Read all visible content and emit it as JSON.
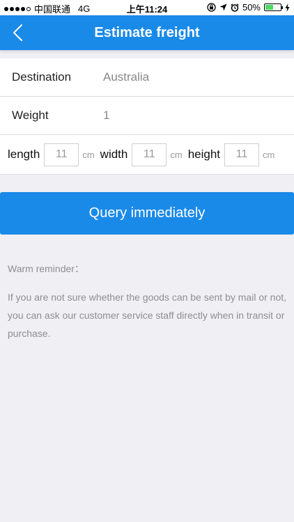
{
  "status_bar": {
    "carrier": "中国联通",
    "network": "4G",
    "time": "上午11:24",
    "battery": "50%",
    "battery_level": 0.5,
    "icons": [
      "orientation-lock-icon",
      "location-icon",
      "alarm-icon",
      "charging-icon"
    ]
  },
  "nav": {
    "title": "Estimate freight",
    "back_icon": "chevron-left-icon"
  },
  "form": {
    "destination_label": "Destination",
    "destination_value": "Australia",
    "weight_label": "Weight",
    "weight_value": "1",
    "length_label": "length",
    "length_value": "11",
    "width_label": "width",
    "width_value": "11",
    "height_label": "height",
    "height_value": "11",
    "unit": "cm"
  },
  "query_button": "Query immediately",
  "reminder": {
    "title": "Warm reminder：",
    "text": "If you are not sure whether the goods can be sent by mail or not, you can ask our customer service staff directly when in transit or purchase."
  },
  "colors": {
    "accent": "#1a8ae8",
    "background": "#efeff4",
    "battery": "#4cd964"
  }
}
